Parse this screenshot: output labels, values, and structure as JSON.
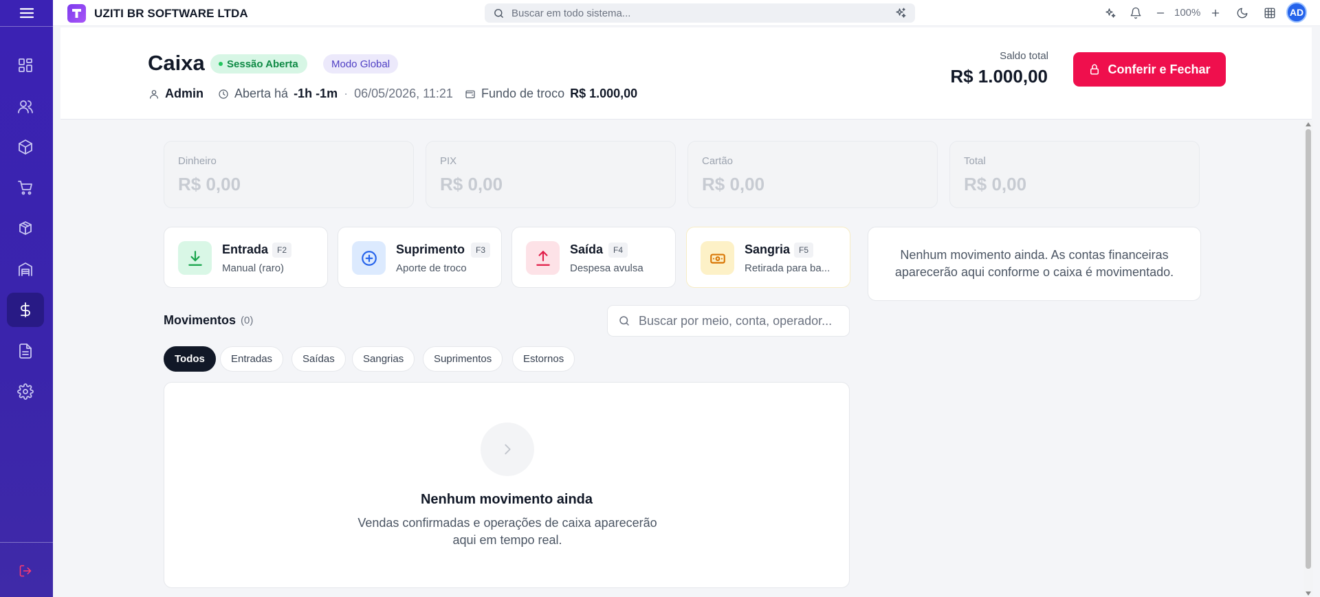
{
  "app": {
    "company_name": "UZITI BR SOFTWARE LTDA",
    "global_search_placeholder": "Buscar em todo sistema...",
    "zoom_level": "100%",
    "avatar_initials": "AD",
    "brand_color": "#7c3aed"
  },
  "sidebar": {
    "items": [
      {
        "icon": "dashboard-icon"
      },
      {
        "icon": "users-icon"
      },
      {
        "icon": "box-icon"
      },
      {
        "icon": "cart-icon"
      },
      {
        "icon": "packages-icon"
      },
      {
        "icon": "warehouse-icon"
      },
      {
        "icon": "dollar-icon",
        "active": true
      },
      {
        "icon": "document-icon"
      },
      {
        "icon": "gear-icon"
      }
    ],
    "logout_icon": "logout-icon"
  },
  "header": {
    "title": "Caixa",
    "status_badge": "Sessão Aberta",
    "mode_badge": "Modo Global",
    "user": "Admin",
    "opened_label": "Aberta há",
    "opened_duration": "-1h -1m",
    "separator": "·",
    "opened_datetime": "06/05/2026, 11:21",
    "fund_label": "Fundo de troco",
    "fund_value": "R$ 1.000,00",
    "saldo_label": "Saldo total",
    "saldo_value": "R$ 1.000,00",
    "close_button": "Conferir e Fechar",
    "close_button_color": "#ef0f4d"
  },
  "summary": [
    {
      "label": "Dinheiro",
      "value": "R$ 0,00"
    },
    {
      "label": "PIX",
      "value": "R$ 0,00"
    },
    {
      "label": "Cartão",
      "value": "R$ 0,00"
    },
    {
      "label": "Total",
      "value": "R$ 0,00"
    }
  ],
  "actions": [
    {
      "title": "Entrada",
      "key": "F2",
      "subtitle": "Manual (raro)",
      "icon": "download-icon",
      "color": "#16a34a"
    },
    {
      "title": "Suprimento",
      "key": "F3",
      "subtitle": "Aporte de troco",
      "icon": "plus-circle-icon",
      "color": "#2563eb"
    },
    {
      "title": "Saída",
      "key": "F4",
      "subtitle": "Despesa avulsa",
      "icon": "upload-icon",
      "color": "#e11d48"
    },
    {
      "title": "Sangria",
      "key": "F5",
      "subtitle": "Retirada para ba...",
      "icon": "banknote-icon",
      "color": "#d97706"
    }
  ],
  "accounts_info": "Nenhum movimento ainda. As contas financeiras aparecerão aqui conforme o caixa é movimentado.",
  "movements": {
    "title": "Movimentos",
    "count": "(0)",
    "search_placeholder": "Buscar por meio, conta, operador...",
    "filters": [
      "Todos",
      "Entradas",
      "Saídas",
      "Sangrias",
      "Suprimentos",
      "Estornos"
    ],
    "active_filter": "Todos",
    "empty_title": "Nenhum movimento ainda",
    "empty_text": "Vendas confirmadas e operações de caixa aparecerão aqui em tempo real."
  }
}
